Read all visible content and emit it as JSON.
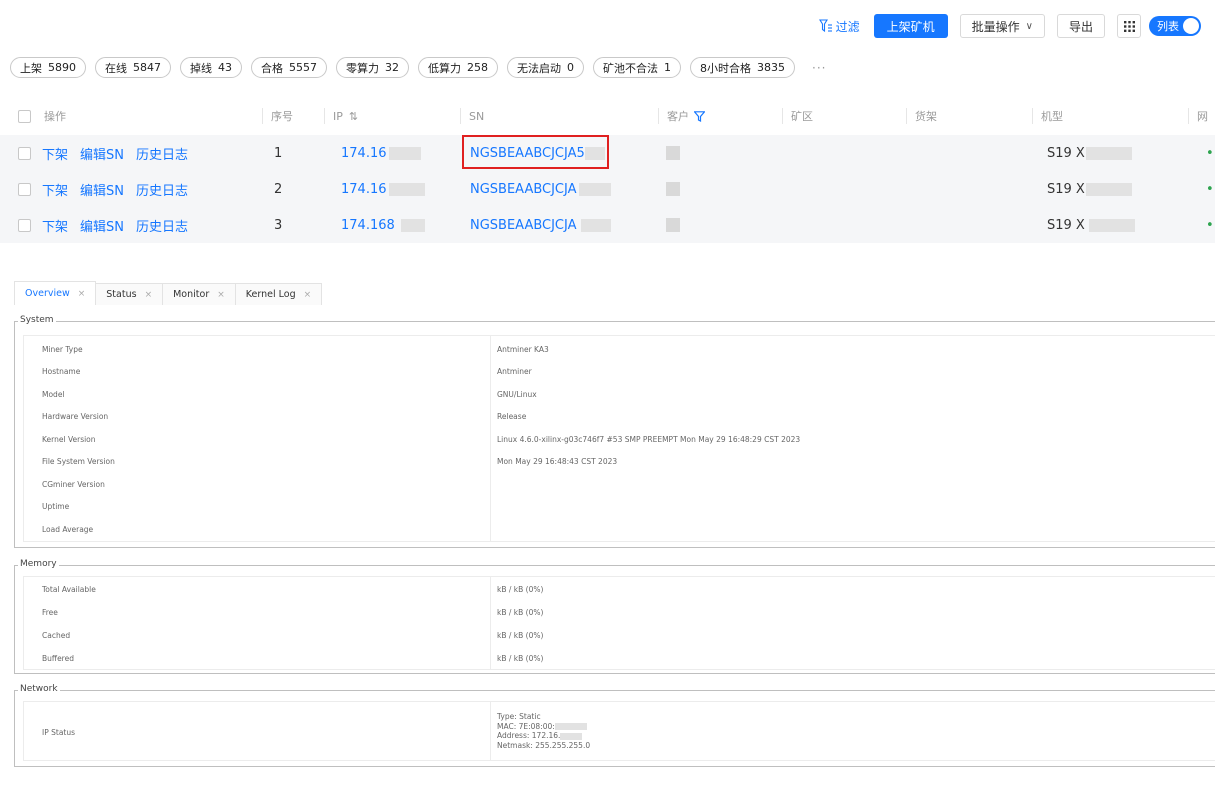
{
  "toolbar": {
    "filter_label": "过滤",
    "shelve_label": "上架矿机",
    "batch_label": "批量操作",
    "export_label": "导出",
    "view_toggle_label": "列表",
    "accent": "#1677ff"
  },
  "stats": [
    {
      "label": "上架",
      "value": "5890"
    },
    {
      "label": "在线",
      "value": "5847"
    },
    {
      "label": "掉线",
      "value": "43"
    },
    {
      "label": "合格",
      "value": "5557"
    },
    {
      "label": "零算力",
      "value": "32"
    },
    {
      "label": "低算力",
      "value": "258"
    },
    {
      "label": "无法启动",
      "value": "0"
    },
    {
      "label": "矿池不合法",
      "value": "1"
    },
    {
      "label": "8小时合格",
      "value": "3835"
    }
  ],
  "stats_more": "···",
  "table": {
    "headers": {
      "ops": "操作",
      "seq": "序号",
      "ip": "IP",
      "sn": "SN",
      "customer": "客户",
      "area": "矿区",
      "shelf": "货架",
      "model": "机型",
      "net": "网"
    },
    "actions": {
      "unshelve": "下架",
      "edit_sn": "编辑SN",
      "history": "历史日志"
    },
    "rows": [
      {
        "seq": "1",
        "ip": "174.16",
        "sn": "NGSBEAABCJCJA5",
        "model": "S19 X",
        "status": "•"
      },
      {
        "seq": "2",
        "ip": "174.16",
        "sn": "NGSBEAABCJCJA",
        "model": "S19 X",
        "status": "•"
      },
      {
        "seq": "3",
        "ip": "174.168",
        "sn": "NGSBEAABCJCJA",
        "model": "S19 X",
        "status": "•"
      }
    ]
  },
  "tabs": [
    {
      "label": "Overview",
      "close": "×"
    },
    {
      "label": "Status",
      "close": "×"
    },
    {
      "label": "Monitor",
      "close": "×"
    },
    {
      "label": "Kernel Log",
      "close": "×"
    }
  ],
  "system": {
    "legend": "System",
    "rows": [
      {
        "key": "Miner Type",
        "value": "Antminer KA3"
      },
      {
        "key": "Hostname",
        "value": "Antminer"
      },
      {
        "key": "Model",
        "value": "GNU/Linux"
      },
      {
        "key": "Hardware Version",
        "value": "Release"
      },
      {
        "key": "Kernel Version",
        "value": "Linux 4.6.0-xilinx-g03c746f7 #53 SMP PREEMPT Mon May 29 16:48:29 CST 2023"
      },
      {
        "key": "File System Version",
        "value": "Mon May 29 16:48:43 CST 2023"
      },
      {
        "key": "CGminer Version",
        "value": ""
      },
      {
        "key": "Uptime",
        "value": ""
      },
      {
        "key": "Load Average",
        "value": ""
      }
    ]
  },
  "memory": {
    "legend": "Memory",
    "rows": [
      {
        "key": "Total Available",
        "value": "kB / kB (0%)"
      },
      {
        "key": "Free",
        "value": "kB / kB (0%)"
      },
      {
        "key": "Cached",
        "value": "kB / kB (0%)"
      },
      {
        "key": "Buffered",
        "value": "kB / kB (0%)"
      }
    ]
  },
  "network": {
    "legend": "Network",
    "key": "IP Status",
    "lines": [
      "Type: Static",
      "MAC: 7E:08:00:",
      "Address: 172.16.",
      "Netmask: 255.255.255.0"
    ]
  }
}
